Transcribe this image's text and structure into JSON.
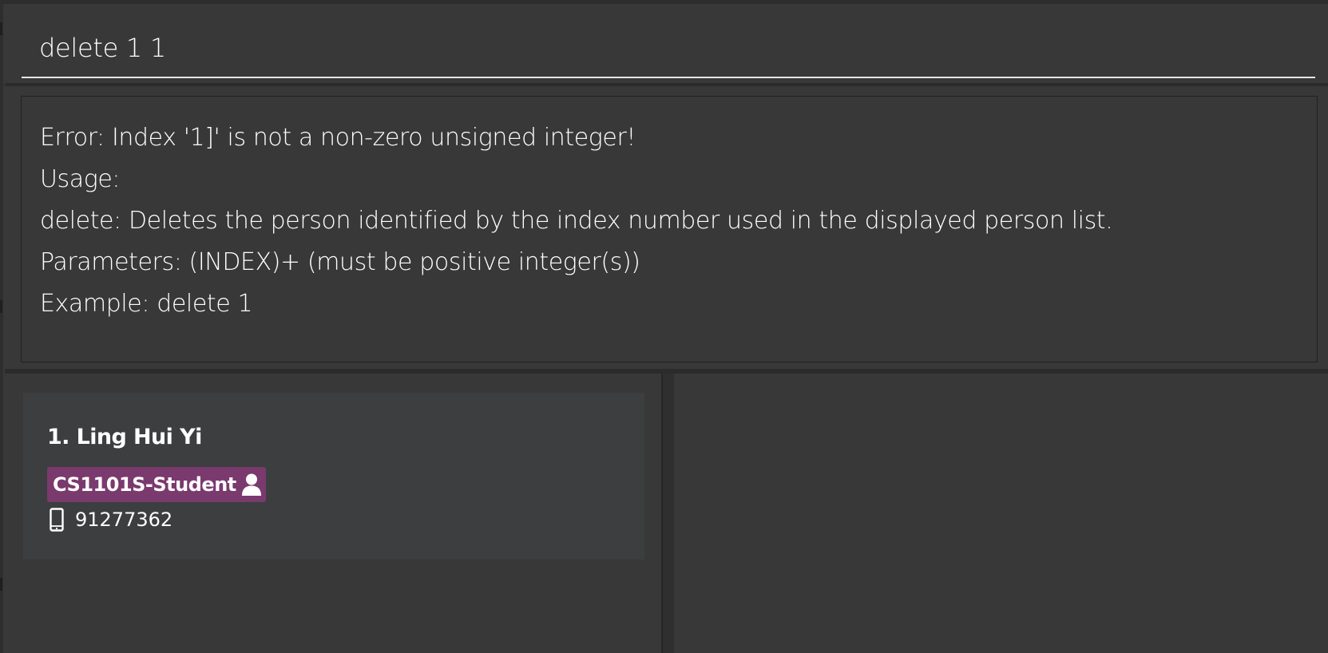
{
  "command": {
    "input_value": "delete 1 1"
  },
  "result": {
    "lines": [
      "Error: Index '1]' is not a non-zero unsigned integer!",
      "Usage:",
      "delete: Deletes the person identified by the index number used in the displayed person list.",
      "Parameters: (INDEX)+ (must be positive integer(s))",
      "Example: delete 1"
    ]
  },
  "person_list": {
    "items": [
      {
        "index_name": "1. Ling Hui Yi",
        "tag": "CS1101S-Student",
        "tag_icon": "person-icon",
        "tag_color": "#7a3a6e",
        "phone_icon": "mobile-phone-icon",
        "phone": "91277362"
      }
    ]
  },
  "colors": {
    "background": "#383838",
    "card": "#3c3e3f",
    "text": "#ffffff"
  }
}
